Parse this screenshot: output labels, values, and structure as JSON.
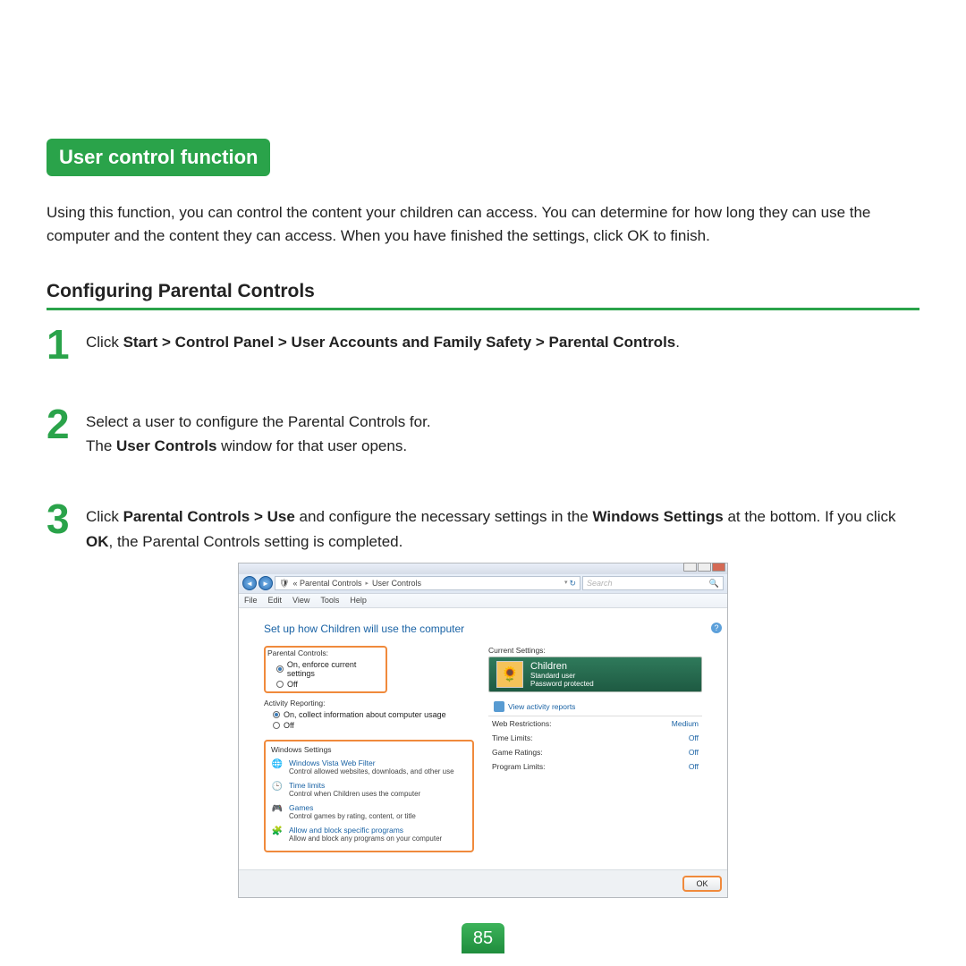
{
  "section_title": "User control function",
  "intro": "Using this function, you can control the content your children can access. You can determine for how long they can use the computer and the content they can access. When you have finished the settings, click OK to finish.",
  "subheading": "Configuring Parental Controls",
  "steps": {
    "s1": {
      "num": "1",
      "pre": "Click ",
      "bold": "Start > Control Panel > User Accounts and Family Safety > Parental Controls",
      "post": "."
    },
    "s2": {
      "num": "2",
      "line1": "Select a user to configure the Parental Controls for.",
      "line2a": "The ",
      "line2b": "User Controls",
      "line2c": " window for that user opens."
    },
    "s3": {
      "num": "3",
      "t1": "Click ",
      "b1": "Parental Controls > Use",
      "t2": " and configure the necessary settings in the ",
      "b2": "Windows Settings",
      "t3": " at the bottom. If you click ",
      "b3": "OK",
      "t4": ", the Parental Controls setting is completed."
    }
  },
  "window": {
    "breadcrumb": {
      "root": "«  Parental Controls",
      "child": "User Controls"
    },
    "search_placeholder": "Search",
    "menu": {
      "file": "File",
      "edit": "Edit",
      "view": "View",
      "tools": "Tools",
      "help": "Help"
    },
    "setup_title": "Set up how Children will use the computer",
    "pc_label": "Parental Controls:",
    "pc_on": "On, enforce current settings",
    "pc_off": "Off",
    "ar_label": "Activity Reporting:",
    "ar_on": "On, collect information about computer usage",
    "ar_off": "Off",
    "ws_label": "Windows Settings",
    "ws": {
      "filter": {
        "link": "Windows Vista Web Filter",
        "desc": "Control allowed websites, downloads, and other use"
      },
      "time": {
        "link": "Time limits",
        "desc": "Control when Children uses the computer"
      },
      "games": {
        "link": "Games",
        "desc": "Control games by rating, content, or title"
      },
      "programs": {
        "link": "Allow and block specific programs",
        "desc": "Allow and block any programs on your computer"
      }
    },
    "cs_label": "Current Settings:",
    "user": {
      "name": "Children",
      "role": "Standard user",
      "pw": "Password protected"
    },
    "view_link": "View activity reports",
    "rows": {
      "web": {
        "k": "Web Restrictions:",
        "v": "Medium"
      },
      "time": {
        "k": "Time Limits:",
        "v": "Off"
      },
      "game": {
        "k": "Game Ratings:",
        "v": "Off"
      },
      "prog": {
        "k": "Program Limits:",
        "v": "Off"
      }
    },
    "ok": "OK"
  },
  "page_number": "85"
}
